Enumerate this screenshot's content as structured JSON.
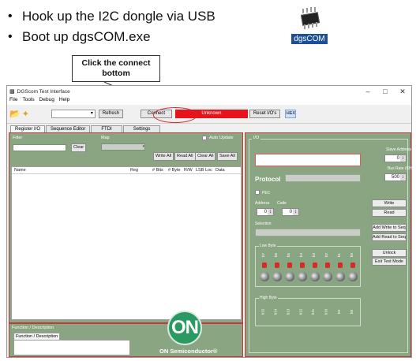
{
  "instructions": [
    "Hook up the I2C dongle via USB",
    "Boot up dgsCOM.exe"
  ],
  "desktop_icon": {
    "label": "dgsCOM",
    "icon": "chip-icon"
  },
  "callout": {
    "text": "Click the connect bottom"
  },
  "window": {
    "title": "DGScom Test Interface",
    "controls": [
      "–",
      "□",
      "✕"
    ],
    "menu": [
      "File",
      "Tools",
      "Debug",
      "Help"
    ],
    "toolbar": {
      "refresh_label": "Refresh",
      "connect_label": "Connect",
      "status_text": "Unknown",
      "status_color": "#e8141b",
      "reset_label": "Reset I/O's",
      "hex_label": "HEX"
    },
    "tabs": [
      "Register I/O",
      "Sequence Editor",
      "FTDI",
      "Settings"
    ],
    "register_io": {
      "filter_label": "Filter",
      "clear_label": "Clear",
      "map_label": "Map",
      "auto_update_label": "Auto Update",
      "buttons": [
        "Write All",
        "Read All",
        "Clear All",
        "Save All"
      ],
      "columns": [
        "Name",
        "Reg",
        "# Bits",
        "# Byte",
        "R/W",
        "LSB Loc",
        "Data"
      ]
    },
    "function_desc": {
      "title": "Function / Description",
      "tab": "Function / Description"
    },
    "logo": {
      "mark": "ON",
      "text": "ON Semiconductor®",
      "color": "#2b9a62"
    },
    "io": {
      "title": "I/O",
      "slave_address_label": "Slave Address",
      "slave_address_value": "0",
      "bus_rate_label": "Bus Rate (KHz)",
      "bus_rate_value": "500",
      "protocol_label": "Protocol",
      "pec_label": "PEC",
      "address_label": "Address",
      "address_value": "0",
      "code_label": "Code",
      "code_value": "0",
      "selection_label": "Selection",
      "write_label": "Write",
      "read_label": "Read",
      "add_write_seq_label": "Add Write to Seq",
      "add_read_seq_label": "Add Read to Seq",
      "unlock_label": "Unlock",
      "exit_test_label": "Exit Test Mode",
      "low_byte_label": "Low Byte",
      "low_bits": [
        "b7",
        "b6",
        "b5",
        "b4",
        "b3",
        "b2",
        "b1",
        "b0"
      ],
      "high_byte_label": "High Byte",
      "high_bits": [
        "b15",
        "b14",
        "b13",
        "b12",
        "b11",
        "b10",
        "b9",
        "b8"
      ]
    }
  }
}
